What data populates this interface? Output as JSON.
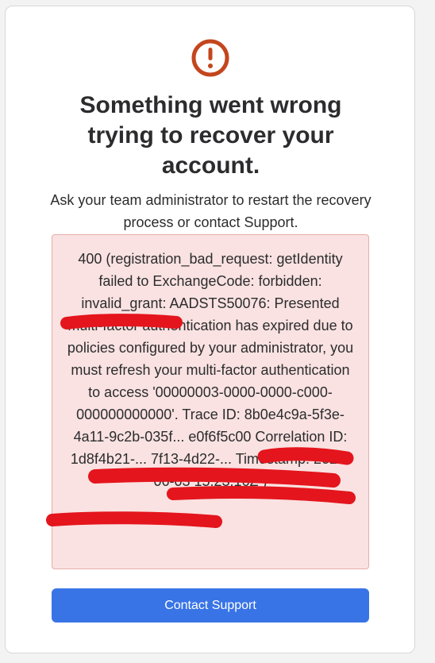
{
  "dialog": {
    "icon": "alert-circle-icon",
    "title": "Something went wrong trying to recover your account.",
    "message": "Ask your team administrator to restart the recovery process or contact Support.",
    "error_details": "400 (registration_bad_request: getIdentity failed to ExchangeCode: forbidden: invalid_grant: AADSTS50076: Presented multi-factor authentication has expired due to policies configured by your administrator, you must refresh your multi-factor authentication to access '00000003-0000-0000-c000-000000000000'. Trace ID: 8b0e4c9a-5f3e-4a11-9c2b-035f... e0f6f5c00 Correlation ID: 1d8f4b21-... 7f13-4d22-... Timestamp: 2025-06-03 15:23:16Z )",
    "contact_button_label": "Contact Support"
  },
  "colors": {
    "accent": "#3974e6",
    "error_icon": "#c3461d",
    "error_bg": "#f9e2e1",
    "error_border": "#e6aeab",
    "redaction": "#e4151d"
  }
}
